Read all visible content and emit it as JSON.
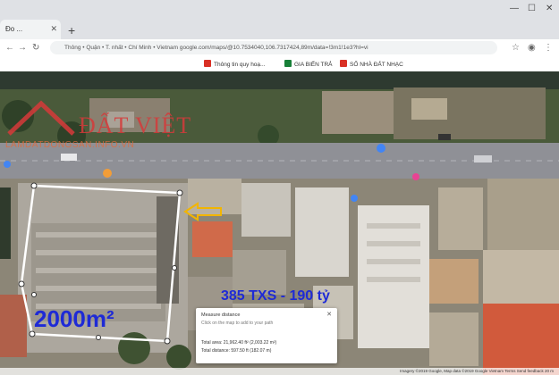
{
  "browser": {
    "tab_title": "Đo ...",
    "address": "google.com/maps/@10.7534040,106.7317424,89m/data=!3m1!1e3?hl=vi",
    "address_prefix": "Thông • Quận • T. nhất • Chí Minh • Vietnam",
    "bookmarks": [
      {
        "label": "Thông tin quy hoạ...",
        "color": "#d93025"
      },
      {
        "label": "GIA BIẾN TRẢ",
        "color": "#188038"
      },
      {
        "label": "SỐ NHÀ ĐẤT NHẠC",
        "color": "#d93025"
      }
    ]
  },
  "watermark": {
    "brand": "ĐẤT VIỆT",
    "domain": "LAMDATDONGSAN.INFO.VN"
  },
  "annotations": {
    "area": "2000m²",
    "price": "385 TXS - 190 tỷ"
  },
  "measure_popup": {
    "title": "Measure distance",
    "hint": "Click on the map to add to your path",
    "area_line": "Total area: 21,962.40 ft² (2,003.22 m²)",
    "distance_line": "Total distance: 597.50 ft (182.07 m)"
  },
  "map_footer": "Imagery ©2019 Google, Map data ©2019 Google   Vietnam   Terms   Send feedback   20 m",
  "colors": {
    "annotation": "#1e2ad6",
    "measure_line": "#ffffff",
    "arrow": "#f2b500"
  }
}
